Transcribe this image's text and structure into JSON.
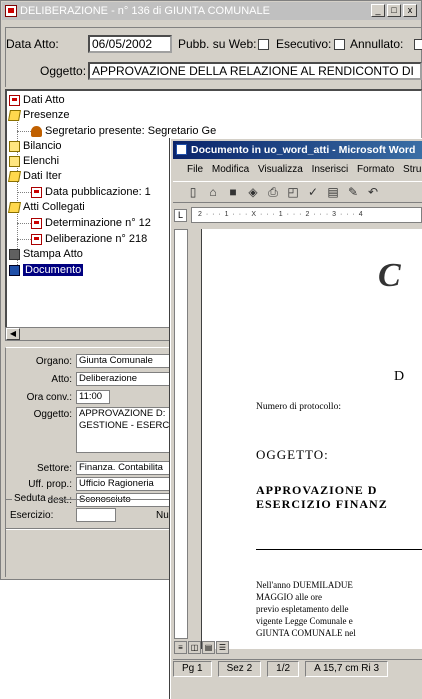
{
  "main_window": {
    "title": "DELIBERAZIONE - n° 136 di GIUNTA COMUNALE",
    "controls": {
      "min": "_",
      "max": "□",
      "close": "x"
    }
  },
  "header": {
    "data_atto_label": "Data Atto:",
    "data_atto_value": "06/05/2002",
    "pubb_web_label": "Pubb. su Web:",
    "esecutivo_label": "Esecutivo:",
    "annullato_label": "Annullato:",
    "oggetto_label": "Oggetto:",
    "oggetto_value": "APPROVAZIONE DELLA RELAZIONE AL RENDICONTO DI"
  },
  "tree": {
    "dati_atto": "Dati Atto",
    "presenze": "Presenze",
    "segretario": "Segretario presente: Segretario Ge",
    "bilancio": "Bilancio",
    "elenchi": "Elenchi",
    "dati_iter": "Dati Iter",
    "data_pubbl": "Data pubblicazione: 1",
    "atti_collegati": "Atti Collegati",
    "determinazione": "Determinazione n° 12",
    "deliberazione": "Deliberazione n° 218",
    "stampa": "Stampa Atto",
    "documento": "Documento"
  },
  "panel": {
    "organo_label": "Organo:",
    "organo_value": "Giunta Comunale",
    "atto_label": "Atto:",
    "atto_value": "Deliberazione",
    "ora_label": "Ora conv.:",
    "ora_value": "11:00",
    "oggetto_label": "Oggetto:",
    "oggetto_line1": "APPROVAZIONE D:",
    "oggetto_line2": "GESTIONE - ESERC",
    "settore_label": "Settore:",
    "settore_value": "Finanza. Contabilita",
    "uff_prop_label": "Uff. prop.:",
    "uff_prop_value": "Ufficio Ragioneria",
    "uff_dest_label": "Uff. dest.:",
    "uff_dest_value": "Sconosciuto",
    "seduta_label": "Seduta",
    "esercizio_label": "Esercizio:",
    "nu_label": "Nu"
  },
  "word": {
    "title": "Documento in uo_word_atti - Microsoft Word",
    "menu": [
      "File",
      "Modifica",
      "Visualizza",
      "Inserisci",
      "Formato",
      "Strum"
    ],
    "ruler": "2 · · · 1 · · · X · · · 1 · · · 2 · · · 3 · · · 4",
    "big_c": "C",
    "big_d": "D",
    "protocollo": "Numero di protocollo:",
    "oggetto_head": "OGGETTO:",
    "approvazione_l1": "APPROVAZIONE  D",
    "approvazione_l2": "ESERCIZIO FINANZ",
    "body_l1": "Nell'anno  DUEMILADUE",
    "body_l2": "MAGGIO  alle  ore",
    "body_l3": "previo  espletamento  delle",
    "body_l4": "vigente Legge Comunale e",
    "body_l5": "GIUNTA COMUNALE nel",
    "status": {
      "page": "Pg 1",
      "sez": "Sez 2",
      "pages": "1/2",
      "pos": "A 15,7 cm  Ri 3"
    }
  }
}
